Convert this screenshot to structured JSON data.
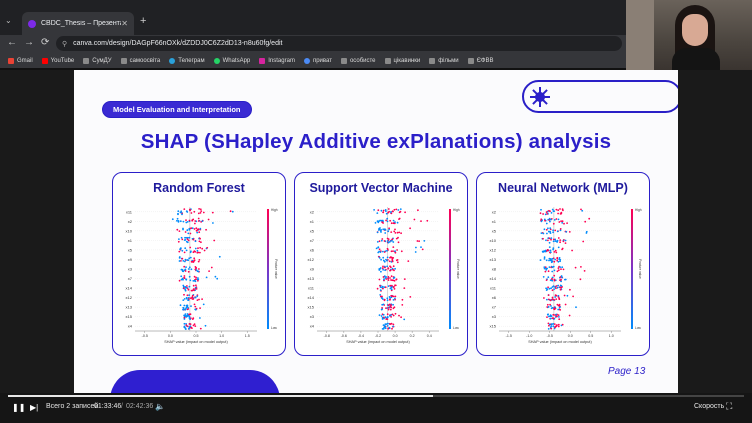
{
  "browser": {
    "tab_title": "CBDC_Thesis – Презентація",
    "tab_close": "✕",
    "new_tab": "+",
    "url": "canva.com/design/DAGpF66nOXk/dZDDJ0C6Z2dD13-n8u60fg/edit",
    "nav": {
      "back": "←",
      "forward": "→",
      "reload": "⟳"
    },
    "bookmarks": [
      {
        "label": "Gmail",
        "color": "#ea4335"
      },
      {
        "label": "YouTube",
        "color": "#ff0000"
      },
      {
        "label": "СумДУ",
        "color": "#8a8a8a"
      },
      {
        "label": "самоосвіта",
        "color": "#8a8a8a"
      },
      {
        "label": "Телеграм",
        "color": "#2aa1da"
      },
      {
        "label": "WhatsApp",
        "color": "#25d366"
      },
      {
        "label": "Instagram",
        "color": "#d6249f"
      },
      {
        "label": "приват",
        "color": "#4c8bf5"
      },
      {
        "label": "особисте",
        "color": "#8a8a8a"
      },
      {
        "label": "цікавинки",
        "color": "#8a8a8a"
      },
      {
        "label": "фільми",
        "color": "#8a8a8a"
      },
      {
        "label": "ЄФВВ",
        "color": "#8a8a8a"
      }
    ]
  },
  "slide": {
    "section_label": "Model Evaluation and Interpretation",
    "title": "SHAP (SHapley Additive exPlanations) analysis",
    "page": "Page 13",
    "colors": {
      "accent": "#2b1fc9",
      "high": "#ff0052",
      "low": "#008bfb"
    },
    "plots": [
      {
        "title": "Random Forest",
        "features": [
          "x11",
          "x2",
          "x10",
          "x1",
          "x5",
          "x9",
          "x3",
          "x7",
          "x14",
          "x12",
          "x13",
          "x15",
          "x4"
        ],
        "ticks": [
          "-0.5",
          "0.0",
          "0.5",
          "1.0",
          "1.5"
        ],
        "xlabel": "SHAP value (impact on model output)",
        "bar_high": "High",
        "bar_low": "Low",
        "bar_label": "Feature value"
      },
      {
        "title": "Support Vector Machine",
        "features": [
          "x2",
          "x1",
          "x5",
          "x7",
          "x6",
          "x12",
          "x9",
          "x13",
          "x11",
          "x14",
          "x15",
          "x3",
          "x4"
        ],
        "ticks": [
          "-0.8",
          "-0.6",
          "-0.4",
          "-0.2",
          "0.0",
          "0.2",
          "0.4"
        ],
        "xlabel": "SHAP value (impact on model output)",
        "bar_high": "High",
        "bar_low": "Low",
        "bar_label": "Feature value"
      },
      {
        "title": "Neural Network (MLP)",
        "features": [
          "x2",
          "x1",
          "x5",
          "x10",
          "x12",
          "x13",
          "x8",
          "x14",
          "x11",
          "x6",
          "x7",
          "x3",
          "x15"
        ],
        "ticks": [
          "-1.5",
          "-1.0",
          "-0.5",
          "0.0",
          "0.5",
          "1.0"
        ],
        "xlabel": "SHAP value (impact on model output)",
        "bar_high": "High",
        "bar_low": "Low",
        "bar_label": "Feature value"
      }
    ]
  },
  "player": {
    "play_icon": "❚❚",
    "next_icon": "▶|",
    "records": "Всего 2 записей",
    "current_time": "01:33:46",
    "separator": "/",
    "total_time": "02:42:36",
    "volume_icon": "🔈",
    "speed_label": "Скорость",
    "fullscreen_icon": "⛶",
    "progress": 0.577
  }
}
